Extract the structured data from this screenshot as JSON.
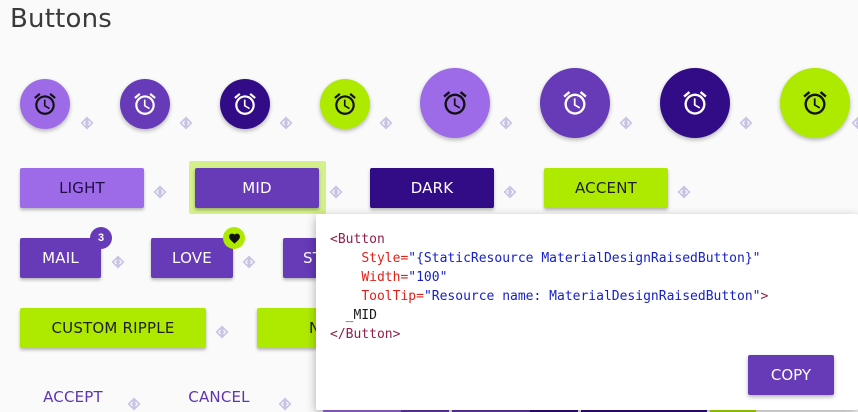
{
  "page": {
    "title": "Buttons"
  },
  "colors": {
    "light": "#9e6be8",
    "mid": "#673ab7",
    "dark": "#320b86",
    "accent": "#aeea00",
    "hint_icon": "#c9c3e4"
  },
  "icons": {
    "fab": "alarm-icon",
    "hint": "code-hint-icon",
    "badge_heart": "heart-icon"
  },
  "raised_buttons": {
    "light": "LIGHT",
    "mid": "MID",
    "dark": "DARK",
    "accent": "ACCENT"
  },
  "badged_buttons": {
    "mail": "MAIL",
    "mail_badge": "3",
    "love": "LOVE",
    "partial": "ST"
  },
  "ripple_buttons": {
    "custom_ripple": "CUSTOM RIPPLE",
    "partial": "N"
  },
  "flat_buttons": {
    "accept": "ACCEPT",
    "cancel": "CANCEL"
  },
  "code_popup": {
    "open_tag": "<Button",
    "style_attr": "Style=",
    "style_value": "\"{StaticResource MaterialDesignRaisedButton}\"",
    "width_attr": "Width=",
    "width_value": "\"100\"",
    "tooltip_attr": "ToolTip=",
    "tooltip_value": "\"Resource name: MaterialDesignRaisedButton\"",
    "tag_close": ">",
    "content": "_MID",
    "close_tag": "</Button>",
    "copy_label": "COPY"
  }
}
